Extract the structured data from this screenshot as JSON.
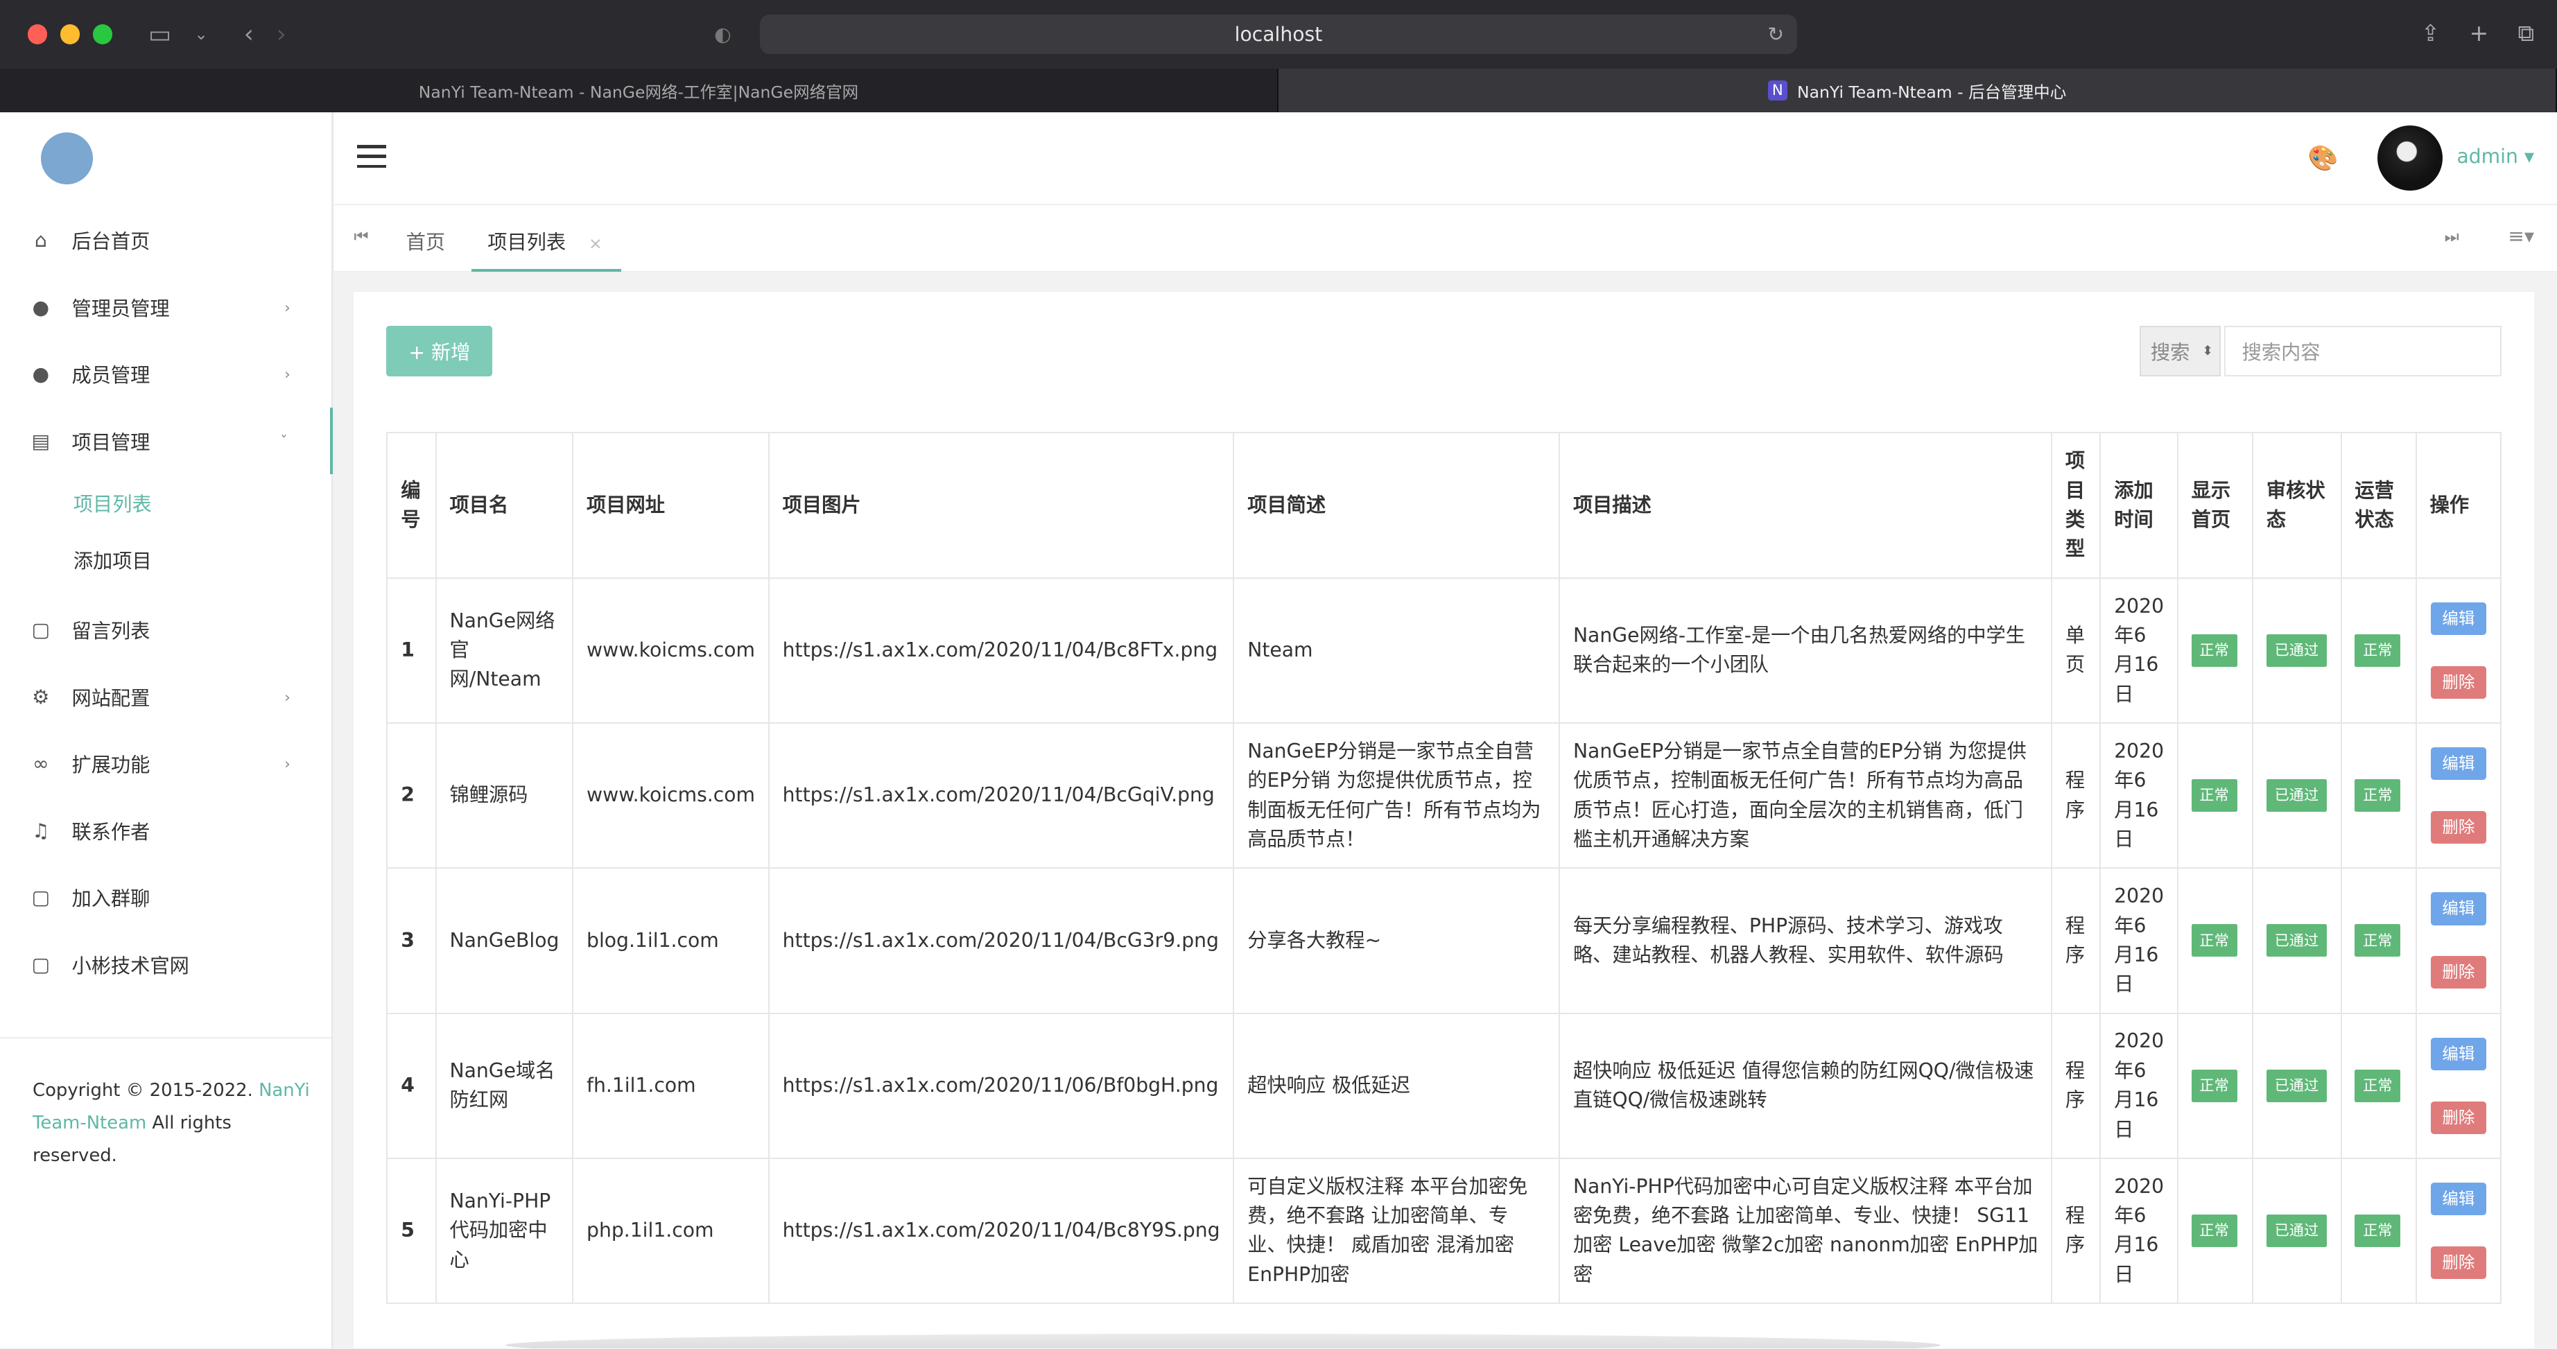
{
  "browser": {
    "url": "localhost",
    "tabs": [
      {
        "title": "NanYi Team-Nteam - NanGe网络-工作室|NanGe网络官网"
      },
      {
        "title": "NanYi Team-Nteam - 后台管理中心",
        "logo": "N"
      }
    ]
  },
  "sidebar": {
    "items": [
      {
        "label": "后台首页",
        "icon": "home-icon"
      },
      {
        "label": "管理员管理",
        "icon": "user-icon",
        "arrow": "›"
      },
      {
        "label": "成员管理",
        "icon": "user-icon",
        "arrow": "›"
      },
      {
        "label": "项目管理",
        "icon": "book-icon",
        "arrow": "ˇ"
      },
      {
        "label": "留言列表",
        "icon": "message-icon"
      },
      {
        "label": "网站配置",
        "icon": "gear-icon",
        "arrow": "›"
      },
      {
        "label": "扩展功能",
        "icon": "link-icon",
        "arrow": "›"
      },
      {
        "label": "联系作者",
        "icon": "bell-icon"
      },
      {
        "label": "加入群聊",
        "icon": "chat-icon"
      },
      {
        "label": "小彬技术官网",
        "icon": "chat-icon"
      }
    ],
    "subitems": [
      {
        "label": "项目列表"
      },
      {
        "label": "添加项目"
      }
    ],
    "copyright_prefix": "Copyright © 2015-2022. ",
    "copyright_link": "NanYi Team-Nteam",
    "copyright_suffix": " All rights reserved."
  },
  "header": {
    "user": "admin"
  },
  "page_tabs": [
    {
      "label": "首页"
    },
    {
      "label": "项目列表",
      "close": "×"
    }
  ],
  "toolbar": {
    "add_label": "+ 新增",
    "search_select": "搜索",
    "search_placeholder": "搜索内容"
  },
  "table": {
    "headers": [
      "编号",
      "项目名",
      "项目网址",
      "项目图片",
      "项目简述",
      "项目描述",
      "项目类型",
      "添加时间",
      "显示首页",
      "审核状态",
      "运营状态",
      "操作"
    ],
    "edit_label": "编辑",
    "delete_label": "删除",
    "rows": [
      {
        "id": "1",
        "name": "NanGe网络官网/Nteam",
        "url": "www.koicms.com",
        "img": "https://s1.ax1x.com/2020/11/04/Bc8FTx.png",
        "brief": "Nteam",
        "desc": "NanGe网络-工作室-是一个由几名热爱网络的中学生联合起来的一个小团队",
        "type": "单页",
        "date": "2020年6月16日",
        "show": "正常",
        "audit": "已通过",
        "op": "正常"
      },
      {
        "id": "2",
        "name": "锦鲤源码",
        "url": "www.koicms.com",
        "img": "https://s1.ax1x.com/2020/11/04/BcGqiV.png",
        "brief": "NanGeEP分销是一家节点全自营的EP分销 为您提供优质节点，控制面板无任何广告！所有节点均为高品质节点！",
        "desc": "NanGeEP分销是一家节点全自营的EP分销 为您提供优质节点，控制面板无任何广告！所有节点均为高品质节点！匠心打造，面向全层次的主机销售商，低门槛主机开通解决方案",
        "type": "程序",
        "date": "2020年6月16日",
        "show": "正常",
        "audit": "已通过",
        "op": "正常"
      },
      {
        "id": "3",
        "name": "NanGeBlog",
        "url": "blog.1il1.com",
        "img": "https://s1.ax1x.com/2020/11/04/BcG3r9.png",
        "brief": "分享各大教程~",
        "desc": "每天分享编程教程、PHP源码、技术学习、游戏攻略、建站教程、机器人教程、实用软件、软件源码",
        "type": "程序",
        "date": "2020年6月16日",
        "show": "正常",
        "audit": "已通过",
        "op": "正常"
      },
      {
        "id": "4",
        "name": "NanGe域名防红网",
        "url": "fh.1il1.com",
        "img": "https://s1.ax1x.com/2020/11/06/Bf0bgH.png",
        "brief": "超快响应 极低延迟",
        "desc": "超快响应 极低延迟 值得您信赖的防红网QQ/微信极速直链QQ/微信极速跳转",
        "type": "程序",
        "date": "2020年6月16日",
        "show": "正常",
        "audit": "已通过",
        "op": "正常"
      },
      {
        "id": "5",
        "name": "NanYi-PHP代码加密中心",
        "url": "php.1il1.com",
        "img": "https://s1.ax1x.com/2020/11/04/Bc8Y9S.png",
        "brief": "可自定义版权注释 本平台加密免费，绝不套路 让加密简单、专业、快捷！ 威盾加密 混淆加密 EnPHP加密",
        "desc": "NanYi-PHP代码加密中心可自定义版权注释 本平台加密免费，绝不套路 让加密简单、专业、快捷！ SG11加密 Leave加密 微擎2c加密 nanonm加密 EnPHP加密",
        "type": "程序",
        "date": "2020年6月16日",
        "show": "正常",
        "audit": "已通过",
        "op": "正常"
      }
    ]
  },
  "colors": {
    "accent": "#5fb8a6",
    "badge": "#5fb878",
    "edit": "#6fa6ea",
    "delete": "#e07b7b"
  }
}
